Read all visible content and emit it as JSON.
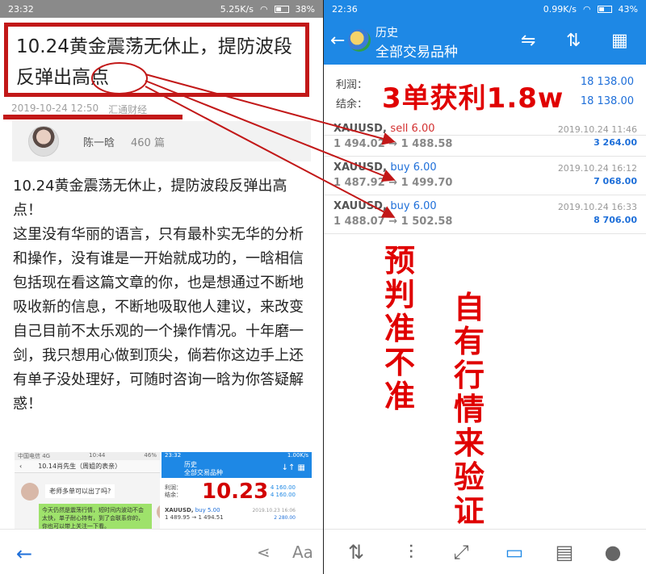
{
  "left": {
    "status": {
      "time": "23:32",
      "speed": "5.25K/s",
      "battery": "38%"
    },
    "title": "10.24黄金震荡无休止，提防波段反弹出高点",
    "date": "2019-10-24 12:50",
    "source": "汇通财经",
    "author": {
      "name": "陈一晗",
      "count": "460 篇"
    },
    "paragraphs": [
      "10.24黄金震荡无休止，提防波段反弹出高点！",
      "这里没有华丽的语言，只有最朴实无华的分析和操作，没有谁是一开始就成功的，一晗相信包括现在看这篇文章的你，也是想通过不断地吸收新的信息，不断地吸取他人建议，来改变自己目前不太乐观的一个操作情况。十年磨一剑，我只想用心做到顶尖，倘若你这边手上还有单子没处理好，可随时咨询一晗为你答疑解惑！"
    ],
    "thumb_chat": {
      "carrier": "中国电信 4G",
      "time": "10:44",
      "battery": "46%",
      "title": "10.14肖先生（周姐的表亲）",
      "msg1": "老师多单可以出了吗?",
      "msg2": "今天仍然是震荡行情，短时间内波动不会太快，单子耐心持有，到了会联系你的，你也可以带上关注一下看。"
    },
    "thumb_trade": {
      "time": "23:32",
      "speed": "1.00K/s",
      "title": "历史",
      "subtitle": "全部交易品种",
      "big": "10.23",
      "profit_label": "利润：",
      "profit": "4 160.00",
      "balance_label": "结余：",
      "balance": "4 160.00",
      "deal_sym": "XAUUSD,",
      "deal_type": "buy 5.00",
      "deal_px": "1 489.95 → 1 494.51",
      "deal_date": "2019.10.23 16:06",
      "deal_pf": "2 280.00"
    },
    "nav": {
      "back": "←",
      "share": "⋖",
      "font": "Aa"
    }
  },
  "right": {
    "status": {
      "time": "22:36",
      "speed": "0.99K/s",
      "battery": "43%"
    },
    "header": {
      "title": "历史",
      "subtitle": "全部交易品种"
    },
    "profit_label": "利润：",
    "profit": "18 138.00",
    "balance_label": "结余：",
    "balance": "18 138.00",
    "headline": "3单获利1.8w",
    "deals": [
      {
        "symbol": "XAUUSD,",
        "type": "sell 6.00",
        "prices": "1 494.02 → 1 488.58",
        "date": "2019.10.24 11:46",
        "profit": "3 264.00"
      },
      {
        "symbol": "XAUUSD,",
        "type": "buy 6.00",
        "prices": "1 487.92 → 1 499.70",
        "date": "2019.10.24 16:12",
        "profit": "7 068.00"
      },
      {
        "symbol": "XAUUSD,",
        "type": "buy 6.00",
        "prices": "1 488.07 → 1 502.58",
        "date": "2019.10.24 16:33",
        "profit": "8 706.00"
      }
    ],
    "vertical1": "预判准不准",
    "vertical2": "自有行情来验证"
  },
  "colors": {
    "accent_red": "#e00000",
    "mt_blue": "#1e88e5",
    "box_red": "#c21818"
  }
}
